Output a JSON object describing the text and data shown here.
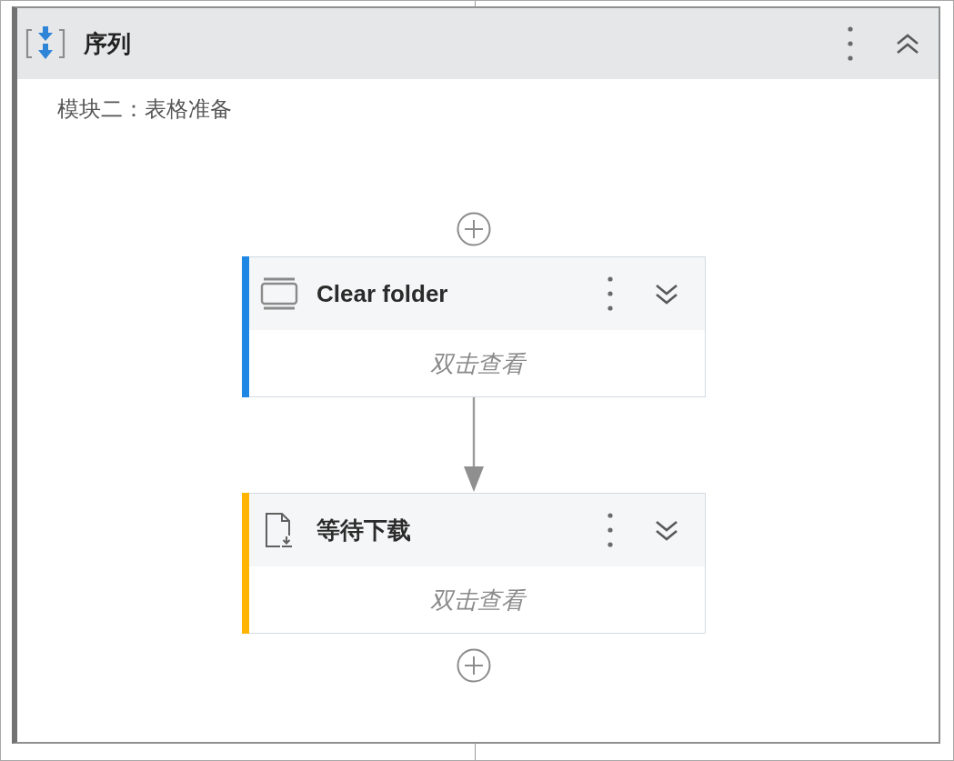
{
  "sequence": {
    "title": "序列",
    "expanded": true,
    "description": "模块二：表格准备"
  },
  "activities": [
    {
      "kind": "window",
      "title": "Clear folder",
      "color": "#1e86e3",
      "expanded": false,
      "hint": "双击查看"
    },
    {
      "kind": "download",
      "title": "等待下载",
      "color": "#ffb400",
      "expanded": false,
      "hint": "双击查看"
    }
  ]
}
